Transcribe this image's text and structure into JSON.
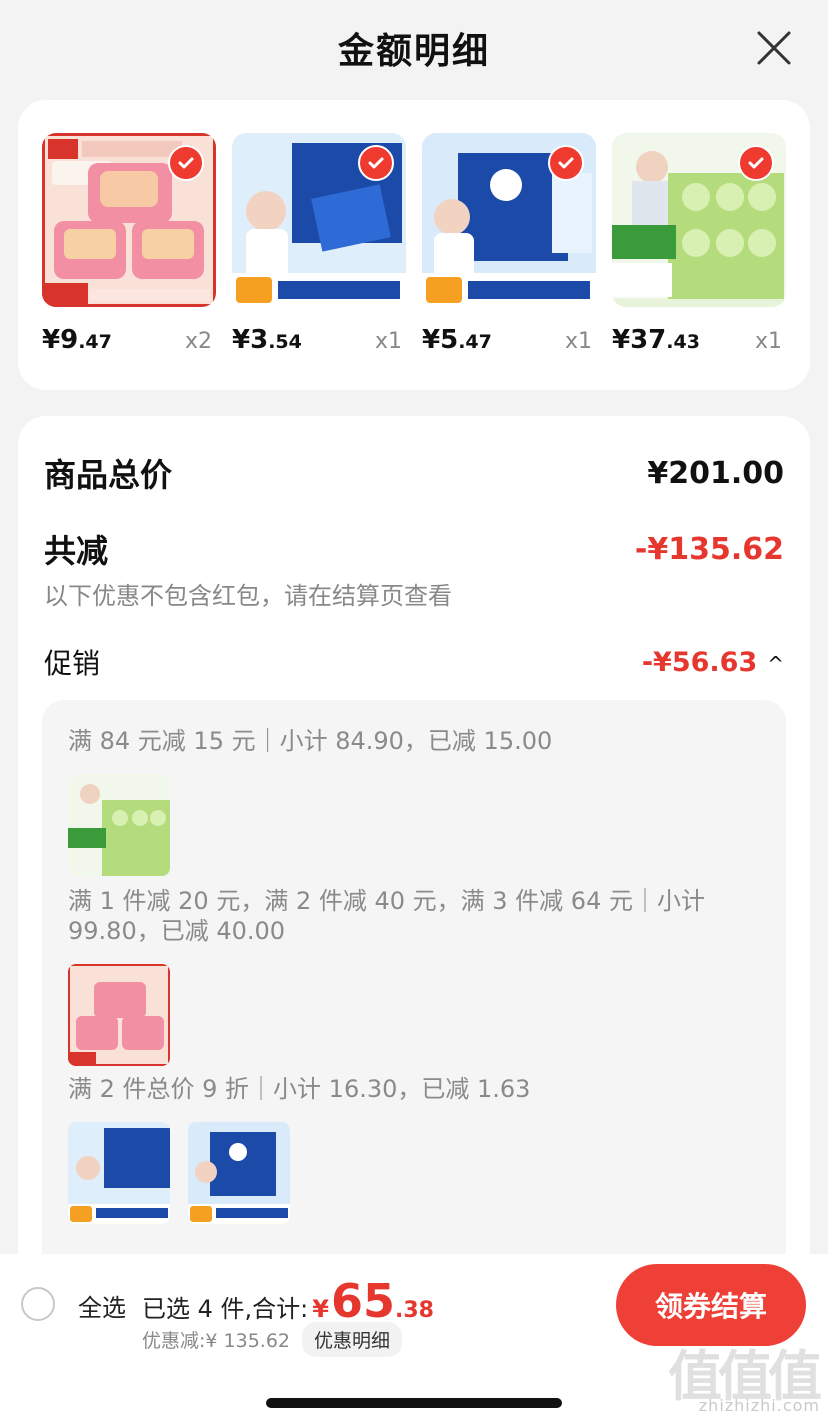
{
  "header": {
    "title": "金额明细"
  },
  "products": [
    {
      "price_int": "¥9",
      "price_dec": ".47",
      "qty": "x2",
      "image": "libby-laundry-pods"
    },
    {
      "price_int": "¥3",
      "price_dec": ".54",
      "qty": "x1",
      "image": "vinda-wet-tissue-12"
    },
    {
      "price_int": "¥5",
      "price_dec": ".47",
      "qty": "x1",
      "image": "vinda-wet-tissue-18"
    },
    {
      "price_int": "¥37",
      "price_dec": ".43",
      "qty": "x1",
      "image": "toilet-paper-rolls"
    }
  ],
  "summary": {
    "total_label": "商品总价",
    "total_value": "¥201.00",
    "reduce_label": "共减",
    "reduce_value": "-¥135.62",
    "note": "以下优惠不包含红包，请在结算页查看",
    "promo_label": "促销",
    "promo_value": "-¥56.63",
    "promo_caret": "^"
  },
  "promotions": [
    {
      "text": "满 84 元减 15 元｜小计 84.90，已减 15.00"
    },
    {
      "text": "满 1 件减 20 元，满 2 件减 40 元，满 3 件减 64 元｜小计 99.80，已减 40.00"
    },
    {
      "text": "满 2 件总价 9 折｜小计 16.30，已减 1.63"
    }
  ],
  "footer": {
    "select_all": "全选",
    "selected_text": "已选 4 件,合计:",
    "currency": "¥",
    "total_int": "65",
    "total_dec": ".38",
    "discount_text": "优惠减:¥ 135.62",
    "detail_link": "优惠明细",
    "checkout": "领券结算"
  },
  "watermark": {
    "logo": "值值值",
    "site": "zhizhizhi.com"
  },
  "colors": {
    "accent": "#e6372e",
    "button": "#ee4036"
  }
}
